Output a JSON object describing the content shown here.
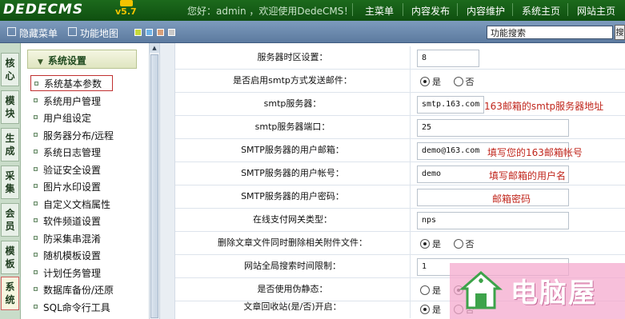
{
  "topbar": {
    "logo": "DEDECMS",
    "version": "v5.7",
    "welcome": "您好：admin ，欢迎使用DedeCMS！",
    "nav": [
      "主菜单",
      "内容发布",
      "内容维护",
      "系统主页",
      "网站主页"
    ]
  },
  "secondbar": {
    "hide_menu": "隐藏菜单",
    "function_map": "功能地图",
    "search_value": "功能搜索",
    "search_button": "搜"
  },
  "left_tabs": [
    "核心",
    "模块",
    "生成",
    "采集",
    "会员",
    "模板",
    "系统"
  ],
  "left_tabs_active": "系统",
  "sidemenu": {
    "section_title": "系统设置",
    "items": [
      "系统基本参数",
      "系统用户管理",
      "用户组设定",
      "服务器分布/远程",
      "系统日志管理",
      "验证安全设置",
      "图片水印设置",
      "自定义文档属性",
      "软件频道设置",
      "防采集串混淆",
      "随机模板设置",
      "计划任务管理",
      "数据库备份/还原",
      "SQL命令行工具"
    ],
    "active_item": "系统基本参数"
  },
  "settings": {
    "rows": [
      {
        "label": "服务器时区设置：",
        "type": "text",
        "value": "8"
      },
      {
        "label": "是否启用smtp方式发送邮件：",
        "type": "radio",
        "options": [
          "是",
          "否"
        ],
        "selected": "是"
      },
      {
        "label": "smtp服务器：",
        "type": "text",
        "value": "smtp.163.com",
        "note": "163邮箱的smtp服务器地址"
      },
      {
        "label": "smtp服务器端口：",
        "type": "text",
        "value": "25"
      },
      {
        "label": "SMTP服务器的用户邮箱：",
        "type": "text",
        "value": "demo@163.com",
        "note": "填写您的163邮箱帐号"
      },
      {
        "label": "SMTP服务器的用户帐号：",
        "type": "text",
        "value": "demo",
        "note": "填写邮箱的用户名"
      },
      {
        "label": "SMTP服务器的用户密码：",
        "type": "password",
        "value": "",
        "note": "邮箱密码"
      },
      {
        "label": "在线支付网关类型：",
        "type": "text",
        "value": "nps"
      },
      {
        "label": "删除文章文件同时删除相关附件文件：",
        "type": "radio",
        "options": [
          "是",
          "否"
        ],
        "selected": "是"
      },
      {
        "label": "网站全局搜索时间限制：",
        "type": "text",
        "value": "1"
      },
      {
        "label": "是否使用伪静态：",
        "type": "radio",
        "options": [
          "是",
          "否"
        ],
        "selected": "否"
      },
      {
        "label": "文章回收站(是/否)开启：",
        "type": "radio",
        "options": [
          "是",
          "否"
        ],
        "selected": "是"
      }
    ]
  },
  "watermark": {
    "text": "电脑屋"
  },
  "colors": {
    "topbar": "#0f4f10",
    "secondbar": "#6d8bae",
    "note_red": "#c0261c",
    "watermark_pink": "#f4aacd"
  }
}
